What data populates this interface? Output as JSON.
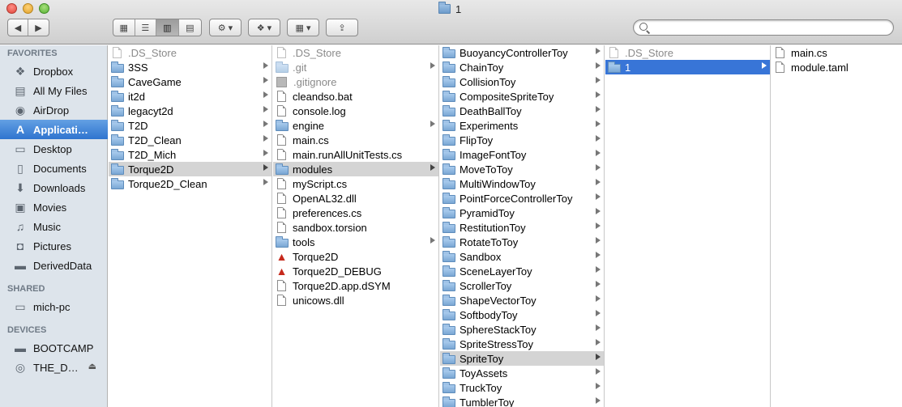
{
  "window": {
    "title": "1"
  },
  "toolbar": {
    "back_label": "◀",
    "forward_label": "▶",
    "view_icons_label": "▦",
    "view_list_label": "☰",
    "view_columns_label": "▥",
    "view_coverflow_label": "▤",
    "action_label": "⚙ ▾",
    "dropbox_label": "❖ ▾",
    "arrange_label": "▦ ▾",
    "share_label": "⇪",
    "search_placeholder": "",
    "search_value": ""
  },
  "sidebar": {
    "favorites_heading": "FAVORITES",
    "favorites": [
      {
        "label": "Dropbox",
        "icon": "dropbox-icon",
        "glyph": "❖"
      },
      {
        "label": "All My Files",
        "icon": "all-files-icon",
        "glyph": "▤"
      },
      {
        "label": "AirDrop",
        "icon": "airdrop-icon",
        "glyph": "◉"
      },
      {
        "label": "Applicati…",
        "icon": "applications-icon",
        "glyph": "A"
      },
      {
        "label": "Desktop",
        "icon": "desktop-icon",
        "glyph": "▭"
      },
      {
        "label": "Documents",
        "icon": "documents-icon",
        "glyph": "▯"
      },
      {
        "label": "Downloads",
        "icon": "downloads-icon",
        "glyph": "⬇"
      },
      {
        "label": "Movies",
        "icon": "movies-icon",
        "glyph": "▣"
      },
      {
        "label": "Music",
        "icon": "music-icon",
        "glyph": "♫"
      },
      {
        "label": "Pictures",
        "icon": "pictures-icon",
        "glyph": "◘"
      },
      {
        "label": "DerivedData",
        "icon": "folder-icon",
        "glyph": "▬"
      }
    ],
    "shared_heading": "SHARED",
    "shared": [
      {
        "label": "mich-pc",
        "icon": "computer-icon",
        "glyph": "▭"
      }
    ],
    "devices_heading": "DEVICES",
    "devices": [
      {
        "label": "BOOTCAMP",
        "icon": "drive-icon",
        "glyph": "▬"
      },
      {
        "label": "THE_D…",
        "icon": "disc-icon",
        "glyph": "◎",
        "eject": "⏏"
      }
    ]
  },
  "columns": [
    {
      "items": [
        {
          "name": ".DS_Store",
          "kind": "file",
          "dim": true
        },
        {
          "name": "3SS",
          "kind": "folder",
          "arrow": true
        },
        {
          "name": "CaveGame",
          "kind": "folder",
          "arrow": true
        },
        {
          "name": "it2d",
          "kind": "folder",
          "arrow": true
        },
        {
          "name": "legacyt2d",
          "kind": "folder",
          "arrow": true
        },
        {
          "name": "T2D",
          "kind": "folder",
          "arrow": true
        },
        {
          "name": "T2D_Clean",
          "kind": "folder",
          "arrow": true
        },
        {
          "name": "T2D_Mich",
          "kind": "folder",
          "arrow": true
        },
        {
          "name": "Torque2D",
          "kind": "folder",
          "arrow": true,
          "selected": "gray"
        },
        {
          "name": "Torque2D_Clean",
          "kind": "folder",
          "arrow": true
        }
      ]
    },
    {
      "items": [
        {
          "name": ".DS_Store",
          "kind": "file",
          "dim": true
        },
        {
          "name": ".git",
          "kind": "folder",
          "arrow": true,
          "dim": true
        },
        {
          "name": ".gitignore",
          "kind": "gray",
          "dim": true
        },
        {
          "name": "cleandso.bat",
          "kind": "file"
        },
        {
          "name": "console.log",
          "kind": "file"
        },
        {
          "name": "engine",
          "kind": "folder",
          "arrow": true
        },
        {
          "name": "main.cs",
          "kind": "file"
        },
        {
          "name": "main.runAllUnitTests.cs",
          "kind": "file"
        },
        {
          "name": "modules",
          "kind": "folder",
          "arrow": true,
          "selected": "gray"
        },
        {
          "name": "myScript.cs",
          "kind": "file"
        },
        {
          "name": "OpenAL32.dll",
          "kind": "file"
        },
        {
          "name": "preferences.cs",
          "kind": "file"
        },
        {
          "name": "sandbox.torsion",
          "kind": "file"
        },
        {
          "name": "tools",
          "kind": "folder",
          "arrow": true
        },
        {
          "name": "Torque2D",
          "kind": "app"
        },
        {
          "name": "Torque2D_DEBUG",
          "kind": "app"
        },
        {
          "name": "Torque2D.app.dSYM",
          "kind": "file"
        },
        {
          "name": "unicows.dll",
          "kind": "file"
        }
      ]
    },
    {
      "items": [
        {
          "name": "BuoyancyControllerToy",
          "kind": "folder",
          "arrow": true
        },
        {
          "name": "ChainToy",
          "kind": "folder",
          "arrow": true
        },
        {
          "name": "CollisionToy",
          "kind": "folder",
          "arrow": true
        },
        {
          "name": "CompositeSpriteToy",
          "kind": "folder",
          "arrow": true
        },
        {
          "name": "DeathBallToy",
          "kind": "folder",
          "arrow": true
        },
        {
          "name": "Experiments",
          "kind": "folder",
          "arrow": true
        },
        {
          "name": "FlipToy",
          "kind": "folder",
          "arrow": true
        },
        {
          "name": "ImageFontToy",
          "kind": "folder",
          "arrow": true
        },
        {
          "name": "MoveToToy",
          "kind": "folder",
          "arrow": true
        },
        {
          "name": "MultiWindowToy",
          "kind": "folder",
          "arrow": true
        },
        {
          "name": "PointForceControllerToy",
          "kind": "folder",
          "arrow": true
        },
        {
          "name": "PyramidToy",
          "kind": "folder",
          "arrow": true
        },
        {
          "name": "RestitutionToy",
          "kind": "folder",
          "arrow": true
        },
        {
          "name": "RotateToToy",
          "kind": "folder",
          "arrow": true
        },
        {
          "name": "Sandbox",
          "kind": "folder",
          "arrow": true
        },
        {
          "name": "SceneLayerToy",
          "kind": "folder",
          "arrow": true
        },
        {
          "name": "ScrollerToy",
          "kind": "folder",
          "arrow": true
        },
        {
          "name": "ShapeVectorToy",
          "kind": "folder",
          "arrow": true
        },
        {
          "name": "SoftbodyToy",
          "kind": "folder",
          "arrow": true
        },
        {
          "name": "SphereStackToy",
          "kind": "folder",
          "arrow": true
        },
        {
          "name": "SpriteStressToy",
          "kind": "folder",
          "arrow": true
        },
        {
          "name": "SpriteToy",
          "kind": "folder",
          "arrow": true,
          "selected": "gray"
        },
        {
          "name": "ToyAssets",
          "kind": "folder",
          "arrow": true
        },
        {
          "name": "TruckToy",
          "kind": "folder",
          "arrow": true
        },
        {
          "name": "TumblerToy",
          "kind": "folder",
          "arrow": true
        }
      ]
    },
    {
      "items": [
        {
          "name": ".DS_Store",
          "kind": "file",
          "dim": true
        },
        {
          "name": "1",
          "kind": "folder",
          "arrow": true,
          "selected": "blue"
        }
      ]
    },
    {
      "items": [
        {
          "name": "main.cs",
          "kind": "file"
        },
        {
          "name": "module.taml",
          "kind": "file"
        }
      ]
    }
  ]
}
